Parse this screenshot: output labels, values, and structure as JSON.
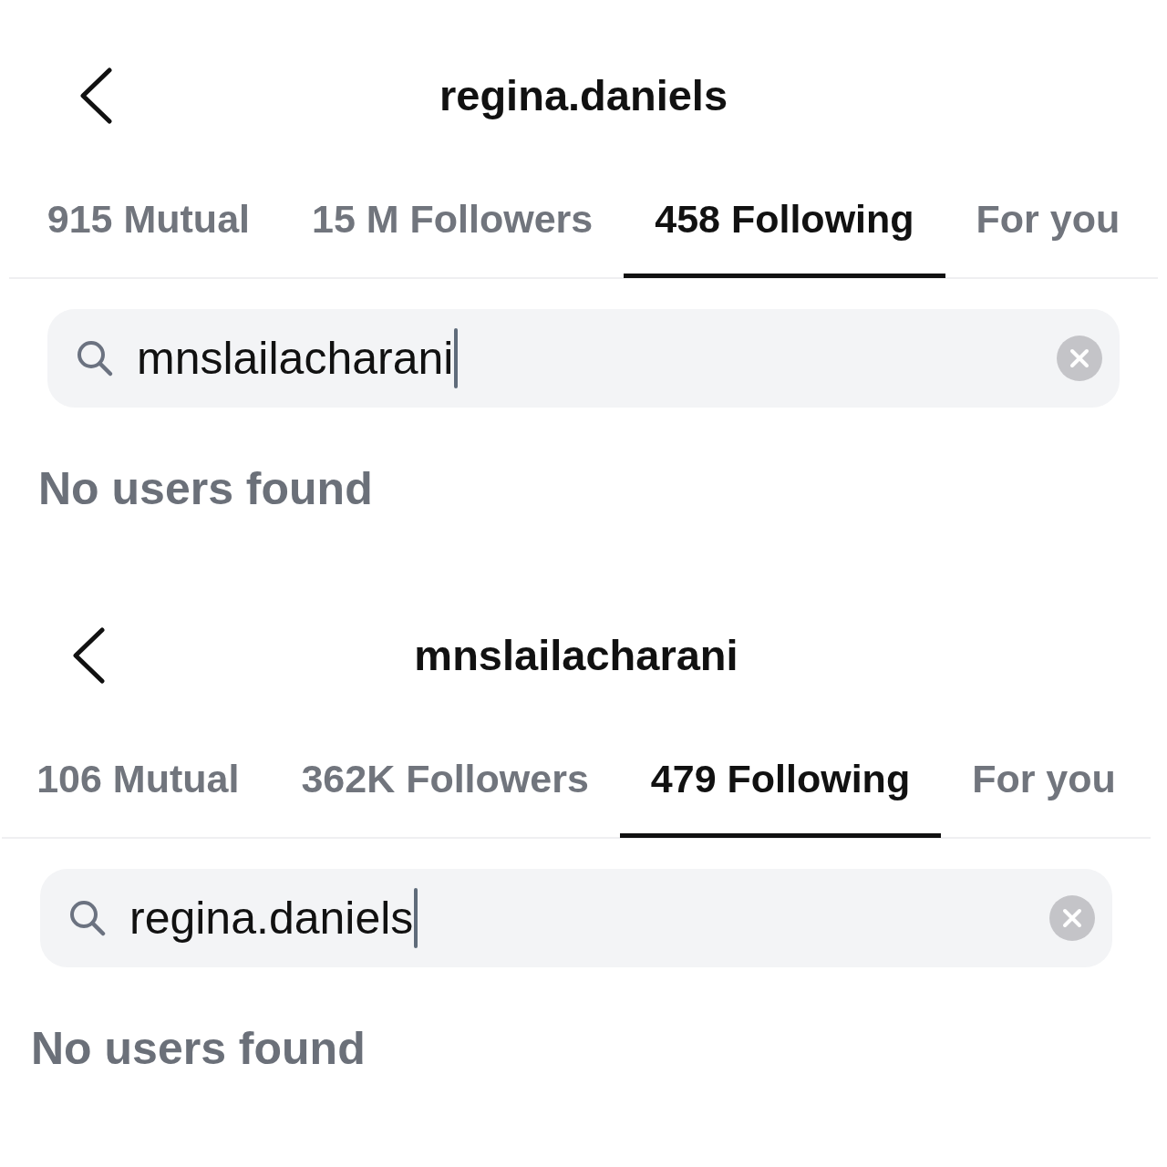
{
  "panels": [
    {
      "header": {
        "title": "regina.daniels"
      },
      "tabs": [
        {
          "label": "915 Mutual",
          "selected": false
        },
        {
          "label": "15 M Followers",
          "selected": false
        },
        {
          "label": "458 Following",
          "selected": true
        },
        {
          "label": "For you",
          "selected": false
        }
      ],
      "search": {
        "value": "mnslailacharani",
        "focused": true
      },
      "empty_message": "No users found"
    },
    {
      "header": {
        "title": "mnslailacharani"
      },
      "tabs": [
        {
          "label": "106 Mutual",
          "selected": false
        },
        {
          "label": "362K Followers",
          "selected": false
        },
        {
          "label": "479 Following",
          "selected": true
        },
        {
          "label": "For you",
          "selected": false
        }
      ],
      "search": {
        "value": "regina.daniels",
        "focused": true
      },
      "empty_message": "No users found"
    }
  ]
}
